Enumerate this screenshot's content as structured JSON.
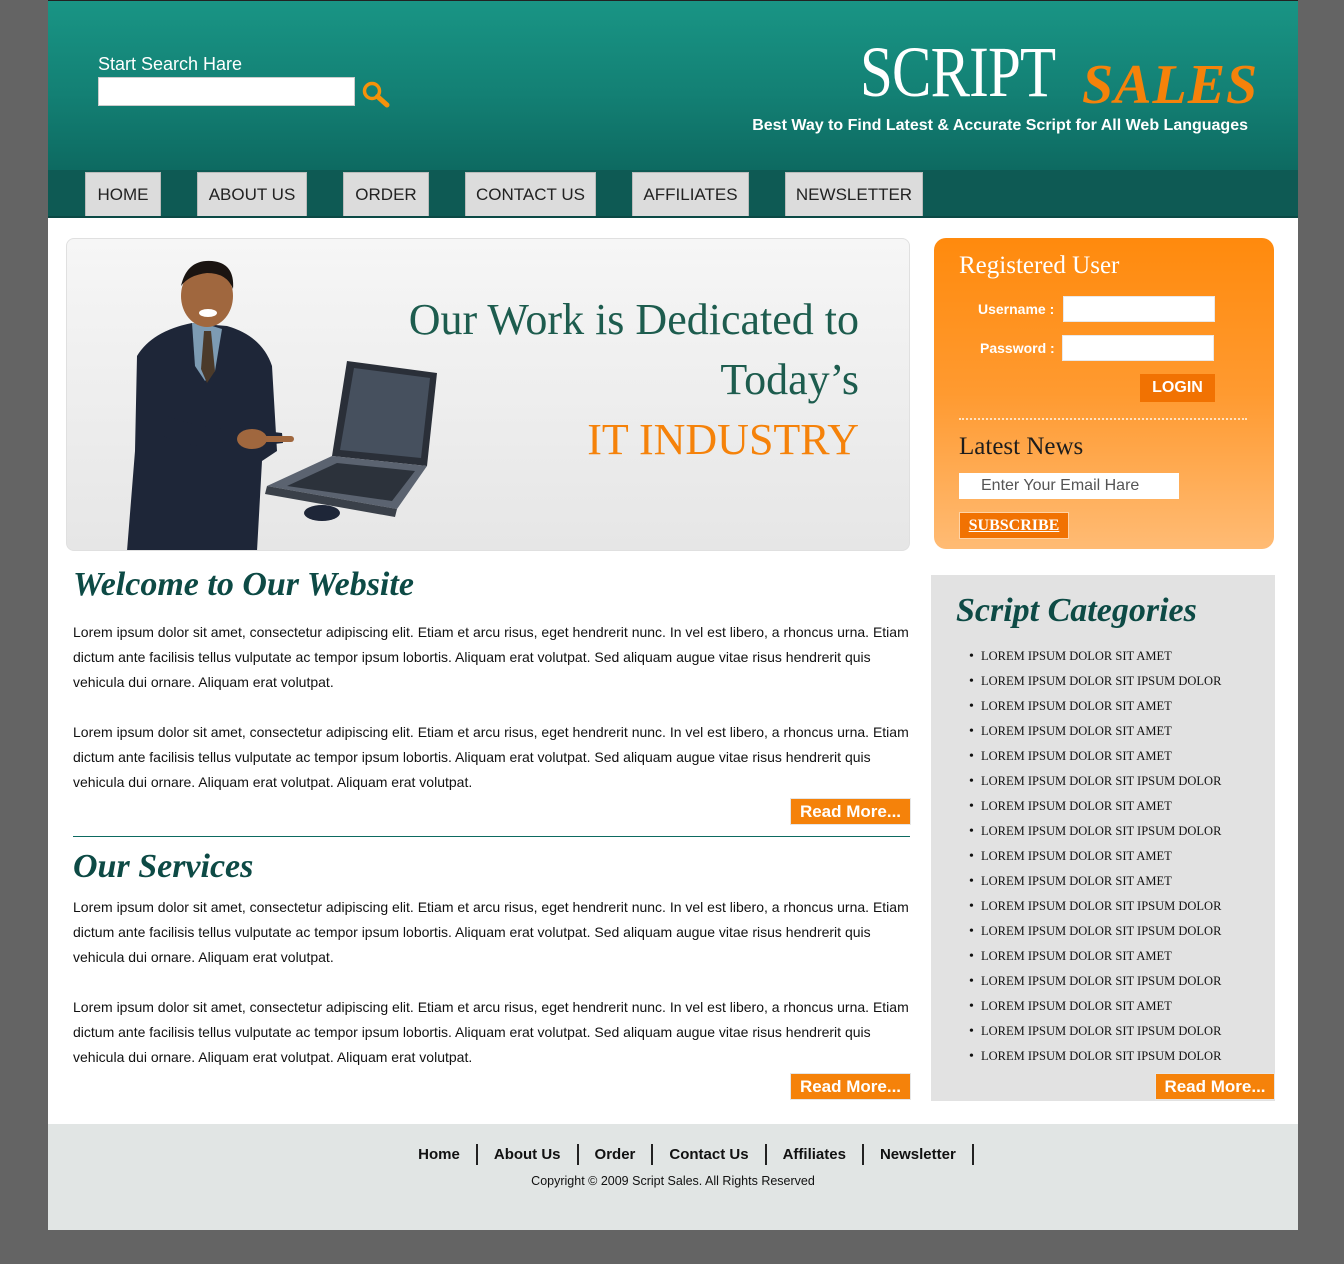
{
  "header": {
    "search_label": "Start Search Hare",
    "search_value": "",
    "logo_script": "SCRIPT",
    "logo_sales": "SALES",
    "tagline": "Best Way to Find Latest & Accurate Script for All Web Languages"
  },
  "nav": {
    "items": [
      "HOME",
      "ABOUT US",
      "ORDER",
      "CONTACT US",
      "AFFILIATES",
      "NEWSLETTER"
    ]
  },
  "hero": {
    "line1": "Our Work is Dedicated to",
    "line2": "Today’s",
    "line3": "IT INDUSTRY"
  },
  "welcome": {
    "title": "Welcome to Our Website",
    "para1": "Lorem ipsum dolor sit amet, consectetur adipiscing elit. Etiam et arcu risus, eget hendrerit nunc. In vel est libero, a rhoncus urna. Etiam dictum ante facilisis tellus vulputate ac tempor ipsum lobortis. Aliquam erat volutpat. Sed aliquam augue vitae risus hendrerit quis vehicula dui ornare. Aliquam erat volutpat.",
    "para2": "Lorem ipsum dolor sit amet, consectetur adipiscing elit. Etiam et arcu risus, eget hendrerit nunc. In vel est libero, a rhoncus urna. Etiam dictum ante facilisis tellus vulputate ac tempor ipsum lobortis. Aliquam erat volutpat. Sed aliquam augue vitae risus hendrerit quis vehicula dui ornare. Aliquam erat volutpat. Aliquam erat volutpat.",
    "read_more": "Read More..."
  },
  "services": {
    "title": "Our Services",
    "para1": "Lorem ipsum dolor sit amet, consectetur adipiscing elit. Etiam et arcu risus, eget hendrerit nunc. In vel est libero, a rhoncus urna. Etiam dictum ante facilisis tellus vulputate ac tempor ipsum lobortis. Aliquam erat volutpat. Sed aliquam augue vitae risus hendrerit quis vehicula dui ornare. Aliquam erat volutpat.",
    "para2": "Lorem ipsum dolor sit amet, consectetur adipiscing elit. Etiam et arcu risus, eget hendrerit nunc. In vel est libero, a rhoncus urna. Etiam dictum ante facilisis tellus vulputate ac tempor ipsum lobortis. Aliquam erat volutpat. Sed aliquam augue vitae risus hendrerit quis vehicula dui ornare. Aliquam erat volutpat. Aliquam erat volutpat.",
    "read_more": "Read More..."
  },
  "login": {
    "title": "Registered User",
    "username_label": "Username :",
    "password_label": "Password :",
    "username_value": "",
    "password_value": "",
    "login_button": "LOGIN",
    "news_title": "Latest News",
    "email_placeholder": "Enter Your Email Hare",
    "subscribe_button": "SUBSCRIBE"
  },
  "categories": {
    "title": "Script Categories",
    "items": [
      "LOREM IPSUM DOLOR SIT AMET",
      "LOREM IPSUM DOLOR SIT IPSUM DOLOR",
      "LOREM IPSUM DOLOR SIT AMET",
      "LOREM IPSUM DOLOR SIT AMET",
      "LOREM IPSUM DOLOR SIT AMET",
      "LOREM IPSUM DOLOR SIT IPSUM DOLOR",
      "LOREM IPSUM DOLOR SIT AMET",
      "LOREM IPSUM DOLOR SIT IPSUM DOLOR",
      "LOREM IPSUM DOLOR SIT AMET",
      "LOREM IPSUM DOLOR SIT AMET",
      "LOREM IPSUM DOLOR SIT IPSUM DOLOR",
      "LOREM IPSUM DOLOR SIT IPSUM DOLOR",
      "LOREM IPSUM DOLOR SIT AMET",
      "LOREM IPSUM DOLOR SIT IPSUM DOLOR",
      "LOREM IPSUM DOLOR SIT AMET",
      "LOREM IPSUM DOLOR SIT IPSUM DOLOR",
      "LOREM IPSUM DOLOR SIT IPSUM DOLOR"
    ],
    "read_more": "Read More..."
  },
  "footer": {
    "links": [
      "Home",
      "About Us",
      "Order",
      "Contact Us",
      "Affiliates",
      "Newsletter"
    ],
    "copyright": "Copyright © 2009 Script Sales. All Rights Reserved"
  },
  "colors": {
    "header_teal": "#138074",
    "nav_dark": "#0e5a54",
    "accent_orange": "#f5820a",
    "heading_green": "#0d4a45"
  },
  "icons": {
    "search": "magnifier-icon"
  }
}
